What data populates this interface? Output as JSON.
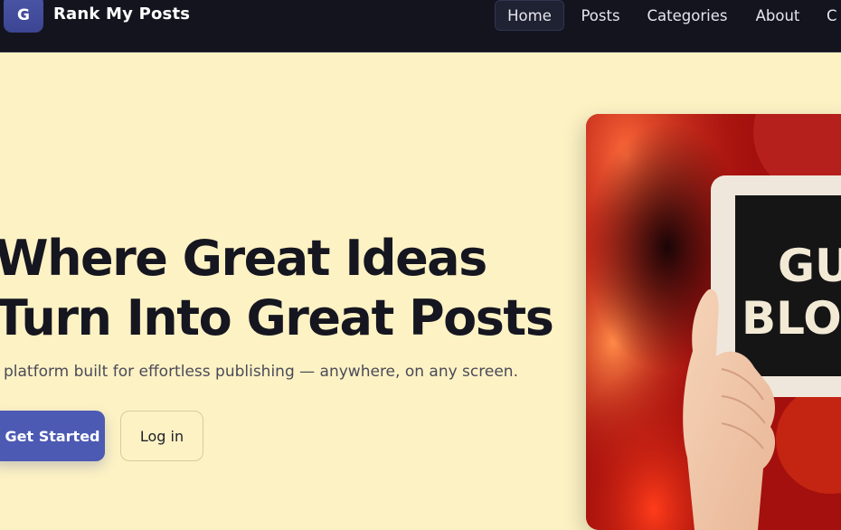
{
  "brand": {
    "logo_letter": "G",
    "name": "Rank My Posts"
  },
  "nav": {
    "items": [
      {
        "label": "Home",
        "active": true
      },
      {
        "label": "Posts",
        "active": false
      },
      {
        "label": "Categories",
        "active": false
      },
      {
        "label": "About",
        "active": false
      },
      {
        "label": "C",
        "active": false
      }
    ]
  },
  "hero": {
    "title_line1": "Where Great Ideas",
    "title_line2": "Turn Into Great Posts",
    "subtitle": "platform built for effortless publishing — anywhere, on any screen.",
    "primary_button": "Get Started",
    "secondary_button": "Log in",
    "image_sign_line1": "GU",
    "image_sign_line2": "BLOG"
  },
  "colors": {
    "page_background": "#fdf2c4",
    "navbar_background": "#14141f",
    "accent": "#4c5ab3",
    "heading_text": "#161620"
  }
}
